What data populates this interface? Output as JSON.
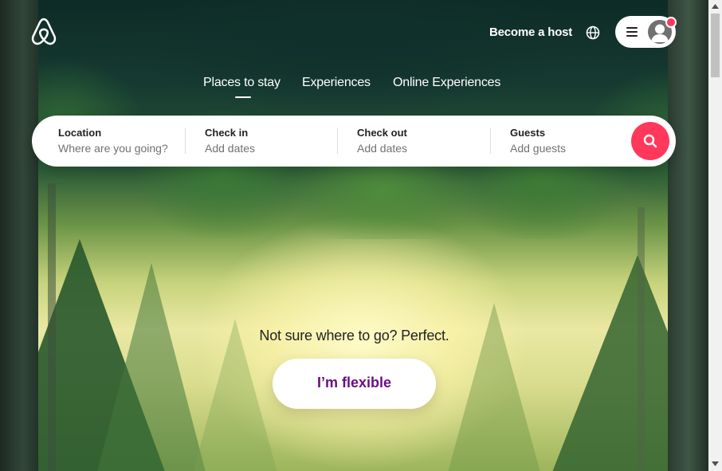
{
  "header": {
    "become_host_label": "Become a host",
    "logo_icon": "airbnb-logo-icon",
    "globe_icon": "globe-icon",
    "menu_icon": "hamburger-menu-icon",
    "avatar_icon": "user-avatar-icon"
  },
  "tabs": [
    {
      "label": "Places to stay",
      "active": true
    },
    {
      "label": "Experiences",
      "active": false
    },
    {
      "label": "Online Experiences",
      "active": false
    }
  ],
  "search": {
    "location": {
      "label": "Location",
      "placeholder": "Where are you going?"
    },
    "check_in": {
      "label": "Check in",
      "placeholder": "Add dates"
    },
    "check_out": {
      "label": "Check out",
      "placeholder": "Add dates"
    },
    "guests": {
      "label": "Guests",
      "placeholder": "Add guests"
    },
    "button_icon": "search-icon"
  },
  "hero": {
    "tagline": "Not sure where to go? Perfect.",
    "button_label": "I’m flexible"
  },
  "colors": {
    "brand": "#ff385c",
    "flexible_text": "#6c0e84"
  }
}
